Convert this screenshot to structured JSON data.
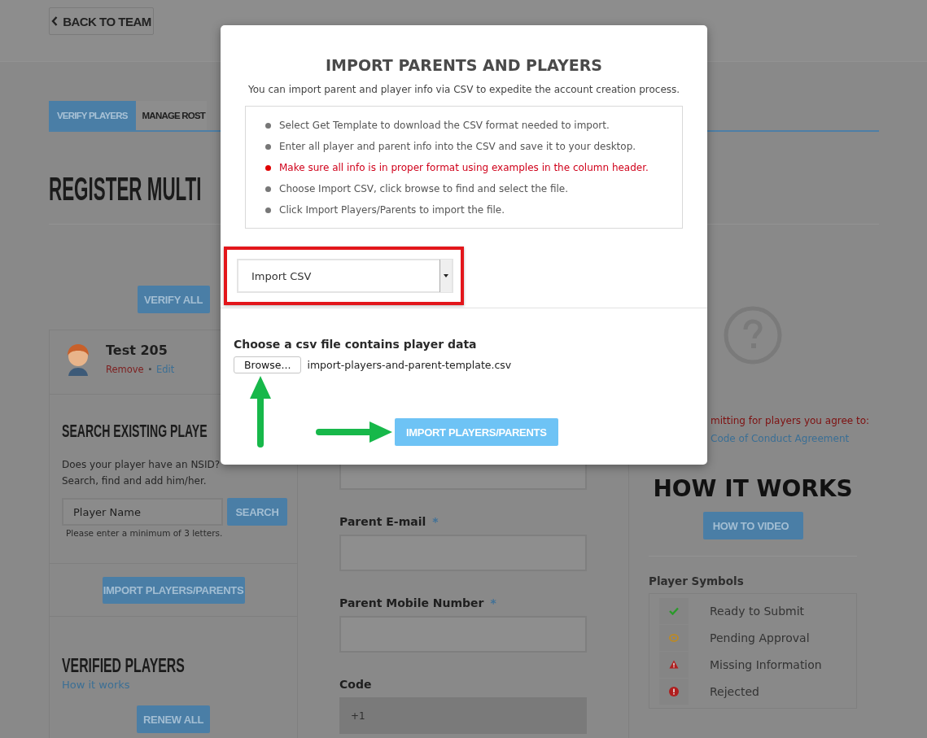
{
  "back_button": {
    "label": "BACK TO TEAM"
  },
  "tabs": [
    {
      "label": "VERIFY PLAYERS",
      "selected": true
    },
    {
      "label": "MANAGE ROST",
      "selected": false
    }
  ],
  "page_title": "REGISTER MULTI",
  "verify_all_button": "VERIFY ALL",
  "player_card": {
    "name": "Test 205",
    "separator": "·",
    "actions": [
      {
        "kind": "danger",
        "label": "Remove"
      },
      {
        "kind": "link",
        "label": "Edit"
      }
    ]
  },
  "search_section": {
    "title": "SEARCH EXISTING PLAYE",
    "description": [
      "Does your player have an NSID?",
      "Search, find and add him/her."
    ],
    "field": {
      "placeholder": "Player Name"
    },
    "button": "SEARCH",
    "hint": "Please enter a minimum of 3 letters."
  },
  "import_button": "IMPORT PLAYERS/PARENTS",
  "verified_section": {
    "title": "VERIFIED PLAYERS",
    "link": "How it works",
    "button": "RENEW ALL"
  },
  "form_fields": [
    {
      "label": "Parent E-mail",
      "required_mark": "*",
      "disabled": false
    },
    {
      "label": "Parent Mobile Number",
      "required_mark": "*",
      "disabled": false
    },
    {
      "label": "Code",
      "value": "+1",
      "disabled": true
    }
  ],
  "agreement": {
    "text": "mitting for players you agree to:",
    "link": "Code of Conduct Agreement"
  },
  "how_it_works": {
    "title": "HOW IT WORKS",
    "button": "HOW TO VIDEO"
  },
  "player_symbols": {
    "title": "Player Symbols",
    "items": [
      {
        "kind": "ready",
        "label": "Ready to Submit"
      },
      {
        "kind": "pending",
        "label": "Pending Approval"
      },
      {
        "kind": "missing",
        "label": "Missing Information"
      },
      {
        "kind": "rejected",
        "label": "Rejected"
      }
    ]
  },
  "modal": {
    "title": "IMPORT PARENTS AND PLAYERS",
    "subtitle": "You can import parent and player info via CSV to expedite the account creation process.",
    "steps": [
      {
        "text": "Select Get Template to download the CSV format needed to import.",
        "highlight": false
      },
      {
        "text": "Enter all player and parent info into the CSV and save it to your desktop.",
        "highlight": false
      },
      {
        "text": "Make sure all info is in proper format using examples in the column header.",
        "highlight": true
      },
      {
        "text": "Choose Import CSV, click browse to find and select the file.",
        "highlight": false
      },
      {
        "text": "Click Import Players/Parents to import the file.",
        "highlight": false
      }
    ],
    "select": {
      "value": "Import CSV"
    },
    "file_label": "Choose a csv file contains player data",
    "browse_button": "Browse...",
    "file_name": "import-players-and-parent-template.csv",
    "import_button": "IMPORT PLAYERS/PARENTS"
  }
}
